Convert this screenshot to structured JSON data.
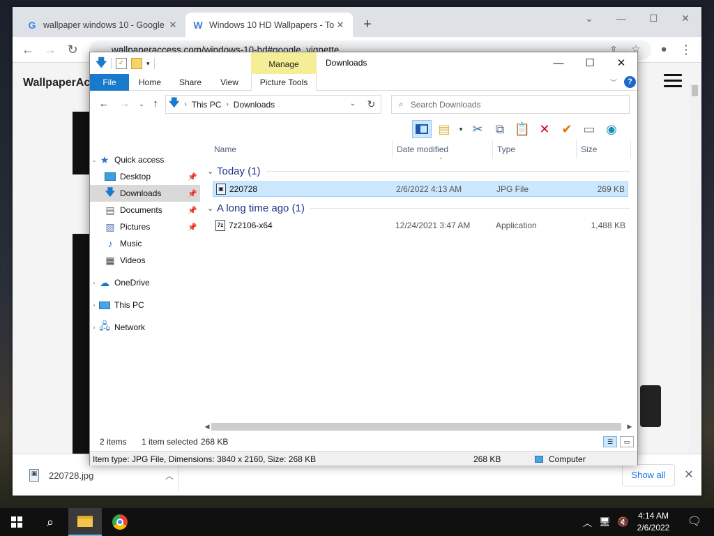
{
  "browser": {
    "tabs": [
      {
        "title": "wallpaper windows 10 - Google S",
        "favicon": "G"
      },
      {
        "title": "Windows 10 HD Wallpapers - To",
        "favicon": "W"
      }
    ],
    "url": "wallpaperaccess.com/windows-10-hd#google_vignette",
    "site_name": "WallpaperAc",
    "download_bar": {
      "file_name": "220728.jpg",
      "show_all_label": "Show all"
    }
  },
  "explorer": {
    "title": "Downloads",
    "contextual_tab_group": "Manage",
    "ribbon_tabs": [
      "File",
      "Home",
      "Share",
      "View",
      "Picture Tools"
    ],
    "breadcrumb": [
      "This PC",
      "Downloads"
    ],
    "search_placeholder": "Search Downloads",
    "columns": [
      "Name",
      "Date modified",
      "Type",
      "Size"
    ],
    "groups": [
      {
        "label": "Today (1)",
        "files": [
          {
            "name": "220728",
            "date": "2/6/2022 4:13 AM",
            "type": "JPG File",
            "size": "269 KB"
          }
        ]
      },
      {
        "label": "A long time ago (1)",
        "files": [
          {
            "name": "7z2106-x64",
            "date": "12/24/2021 3:47 AM",
            "type": "Application",
            "size": "1,488 KB"
          }
        ]
      }
    ],
    "nav": {
      "quick_access": "Quick access",
      "items": [
        "Desktop",
        "Downloads",
        "Documents",
        "Pictures",
        "Music",
        "Videos"
      ],
      "onedrive": "OneDrive",
      "this_pc": "This PC",
      "network": "Network"
    },
    "status": {
      "items": "2 items",
      "selected": "1 item selected",
      "size": "268 KB"
    },
    "details": {
      "info": "Item type: JPG File, Dimensions: 3840 x 2160, Size: 268 KB",
      "size": "268 KB",
      "location": "Computer"
    }
  },
  "taskbar": {
    "time": "4:14 AM",
    "date": "2/6/2022"
  },
  "colors": {
    "accent": "#1979ca",
    "manage": "#f6ee96",
    "selection": "#cce8ff"
  }
}
